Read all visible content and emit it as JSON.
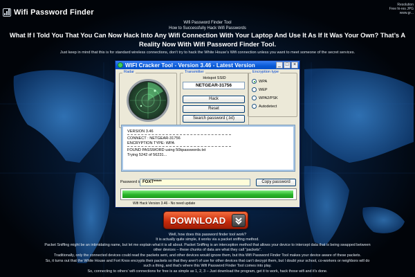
{
  "site": {
    "logo_text": "Wifi Password Finder",
    "corner_lines": [
      "Resolution",
      "Free hi-res JPG",
      "www.gr..."
    ]
  },
  "intro": {
    "line1": "Wifi Password Finder Tool",
    "line2": "How to Successfully Hack Wifi Passwords",
    "headline": "What If I Told You That You Can Now Hack Into Any Wifi Connection With Your Laptop And Use It As If It Was Your Own? That’s A Reality Now With Wifi Password Finder Tool.",
    "note": "Just keep in mind that this is for standard wireless connections, don’t try to hack the White House’s Wifi connection unless you want to meet someone of the secret services."
  },
  "app": {
    "title": "WIFI Cracker Tool - Version 3.46 - Latest Version",
    "window_buttons": [
      "_",
      "□",
      "×"
    ],
    "radar_label": "Radar",
    "transmitter_label": "Transmitter",
    "hotspot_label": "Hotspot SSID",
    "ssid_value": "NETGEAR-31756",
    "hack_label": "Hack",
    "reset_label": "Reset",
    "search_label": "Search password (.txt)",
    "encryption_label": "Encryption type",
    "encryption_options": [
      {
        "label": "WPA",
        "selected": true
      },
      {
        "label": "WEP",
        "selected": false
      },
      {
        "label": "WPA2/PSK",
        "selected": false
      },
      {
        "label": "Autodetect",
        "selected": false
      }
    ],
    "log_lines": [
      "VERSION 3.46",
      "CONNECT : NETGEAR-31756",
      "ENCRYPTION TYPE: WPA",
      "FOUND PASSWORD using 50kpasswords.txt",
      "Trying 5242 of 56231..."
    ],
    "password_label": "Password is:",
    "password_value": "FOXT*****",
    "copy_label": "Copy password",
    "progress_fraction": 0.99,
    "status_text": "Wifi Hack Version 3.46 - No need update"
  },
  "download": {
    "label": "DOWNLOAD"
  },
  "body_text": [
    "Well, how does this password finder tool work?",
    "It is actually quite simple, it works via a packet sniffing method.",
    "Packet Sniffing might be an intimidating name, but let me explain what it is all about. Packet Sniffing is an interception method that allows your device to intercept data that is being swapped between",
    "other devices – these chunks of data are what they call “packets”.",
    "Traditionally, only the connected devices could read the packets sent, and other devices would ignore them, but this Wifi Password Finder Tool makes your device aware of these packets.",
    "So, it turns out that the White House and Fort Knox encrypts their packets so that they aren’t of use for other devices that can’t decrypt them, but I doubt your school, co-workers or neighbors will do",
    "such a thing, and that’s where this Wifi Password Finder Tool comes into play.",
    "So, connecting to others’ wifi connections for free is as simple as 1, 2, 3 – Just download the program, get it to work, hack those wifi and it’s done."
  ],
  "colors": {
    "titlebar": "#0a5ad6",
    "download_button": "#c5290a",
    "progress_green": "#29b529"
  }
}
